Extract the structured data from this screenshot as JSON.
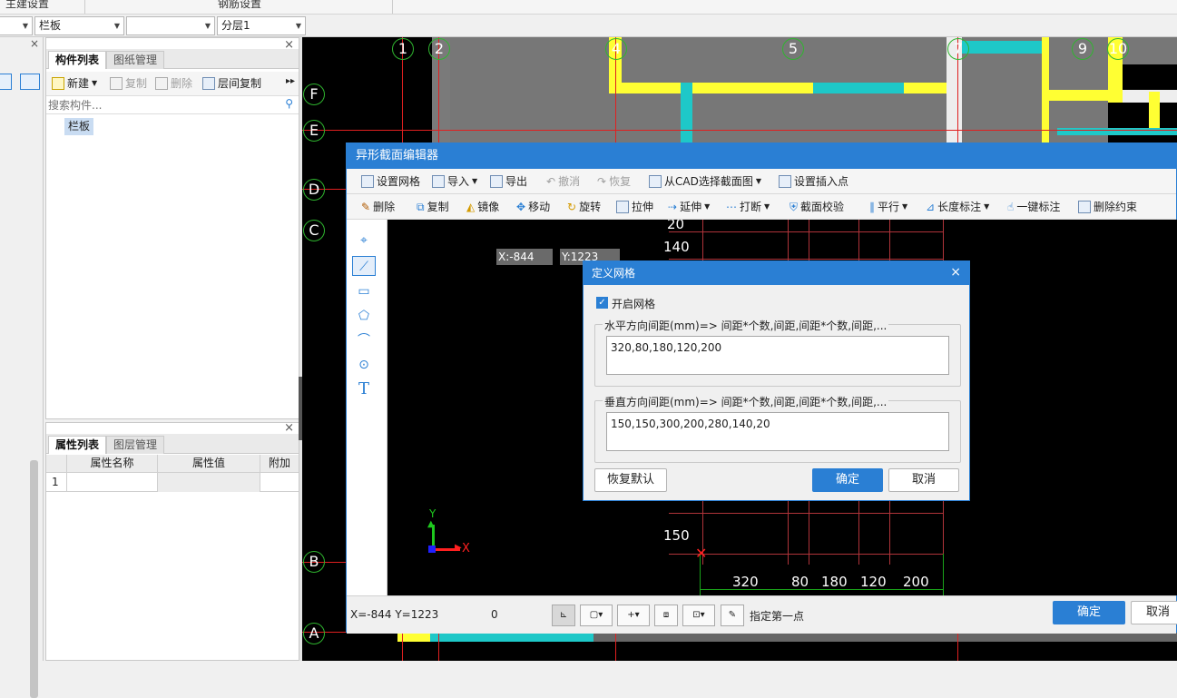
{
  "menu_tabs": [
    "主建设置",
    "钢筋设置"
  ],
  "selectors": {
    "component_type": "栏板",
    "blank": "",
    "layer": "分层1"
  },
  "left_panel": {
    "tabs": [
      "构件列表",
      "图纸管理"
    ],
    "toolbar": {
      "new": "新建",
      "copy": "复制",
      "delete": "删除",
      "floor_copy": "层间复制"
    },
    "search_placeholder": "搜索构件...",
    "items": [
      "栏板"
    ]
  },
  "props_panel": {
    "tabs": [
      "属性列表",
      "图层管理"
    ],
    "columns": [
      "属性名称",
      "属性值",
      "附加"
    ],
    "rows": [
      {
        "index": "1",
        "name": "",
        "value": "",
        "extra": ""
      }
    ]
  },
  "cad_axes": {
    "top": [
      "1",
      "2",
      "4",
      "5",
      "7",
      "9",
      "10"
    ],
    "left": [
      "F",
      "E",
      "D",
      "C",
      "B",
      "A"
    ]
  },
  "section_editor": {
    "title": "异形截面编辑器",
    "toolbar1": [
      "设置网格",
      "导入",
      "导出",
      "撤消",
      "恢复",
      "从CAD选择截面图",
      "设置插入点"
    ],
    "toolbar2": [
      "删除",
      "复制",
      "镜像",
      "移动",
      "旋转",
      "拉伸",
      "延伸",
      "打断",
      "截面校验",
      "平行",
      "长度标注",
      "一键标注",
      "删除约束"
    ],
    "coord_x": "X:-844",
    "coord_y": "Y:1223",
    "dims_top": [
      "20",
      "140"
    ],
    "dim_left": "150",
    "dims_bottom": [
      "320",
      "80",
      "180",
      "120",
      "200"
    ],
    "axis_x": "X",
    "axis_y": "Y",
    "status_coords": "X=-844 Y=1223",
    "status_value": "0",
    "status_prompt": "指定第一点",
    "ok": "确定",
    "cancel": "取消"
  },
  "grid_dialog": {
    "title": "定义网格",
    "enable_label": "开启网格",
    "enabled": true,
    "h_label": "水平方向间距(mm)=> 间距*个数,间距,间距*个数,间距,...",
    "h_value": "320,80,180,120,200",
    "v_label": "垂直方向间距(mm)=> 间距*个数,间距,间距*个数,间距,...",
    "v_value": "150,150,300,200,280,140,20",
    "restore": "恢复默认",
    "ok": "确定",
    "cancel": "取消"
  },
  "colors": {
    "accent": "#2a7fd4",
    "wall_yellow": "#ffff33",
    "wall_cyan": "#1ec8c8",
    "axis_green": "#2fb52f",
    "axis_red": "#e02020"
  }
}
